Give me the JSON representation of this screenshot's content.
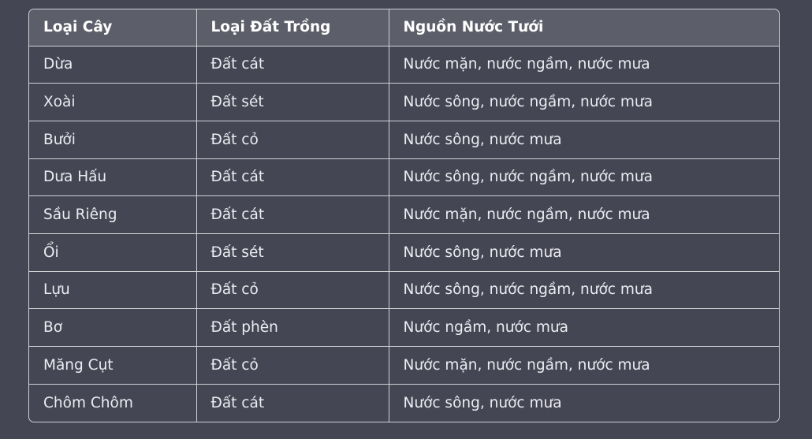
{
  "table": {
    "headers": [
      "Loại Cây",
      "Loại Đất Trồng",
      "Nguồn Nước Tưới"
    ],
    "rows": [
      [
        "Dừa",
        "Đất cát",
        "Nước mặn, nước ngầm, nước mưa"
      ],
      [
        "Xoài",
        "Đất sét",
        "Nước sông, nước ngầm, nước mưa"
      ],
      [
        "Bưởi",
        "Đất cỏ",
        "Nước sông, nước mưa"
      ],
      [
        "Dưa Hấu",
        "Đất cát",
        "Nước sông, nước ngầm, nước mưa"
      ],
      [
        "Sầu Riêng",
        "Đất cát",
        "Nước mặn, nước ngầm, nước mưa"
      ],
      [
        "Ổi",
        "Đất sét",
        "Nước sông, nước mưa"
      ],
      [
        "Lựu",
        "Đất cỏ",
        "Nước sông, nước ngầm, nước mưa"
      ],
      [
        "Bơ",
        "Đất phèn",
        "Nước ngầm, nước mưa"
      ],
      [
        "Măng Cụt",
        "Đất cỏ",
        "Nước mặn, nước ngầm, nước mưa"
      ],
      [
        "Chôm Chôm",
        "Đất cát",
        "Nước sông, nước mưa"
      ]
    ]
  }
}
